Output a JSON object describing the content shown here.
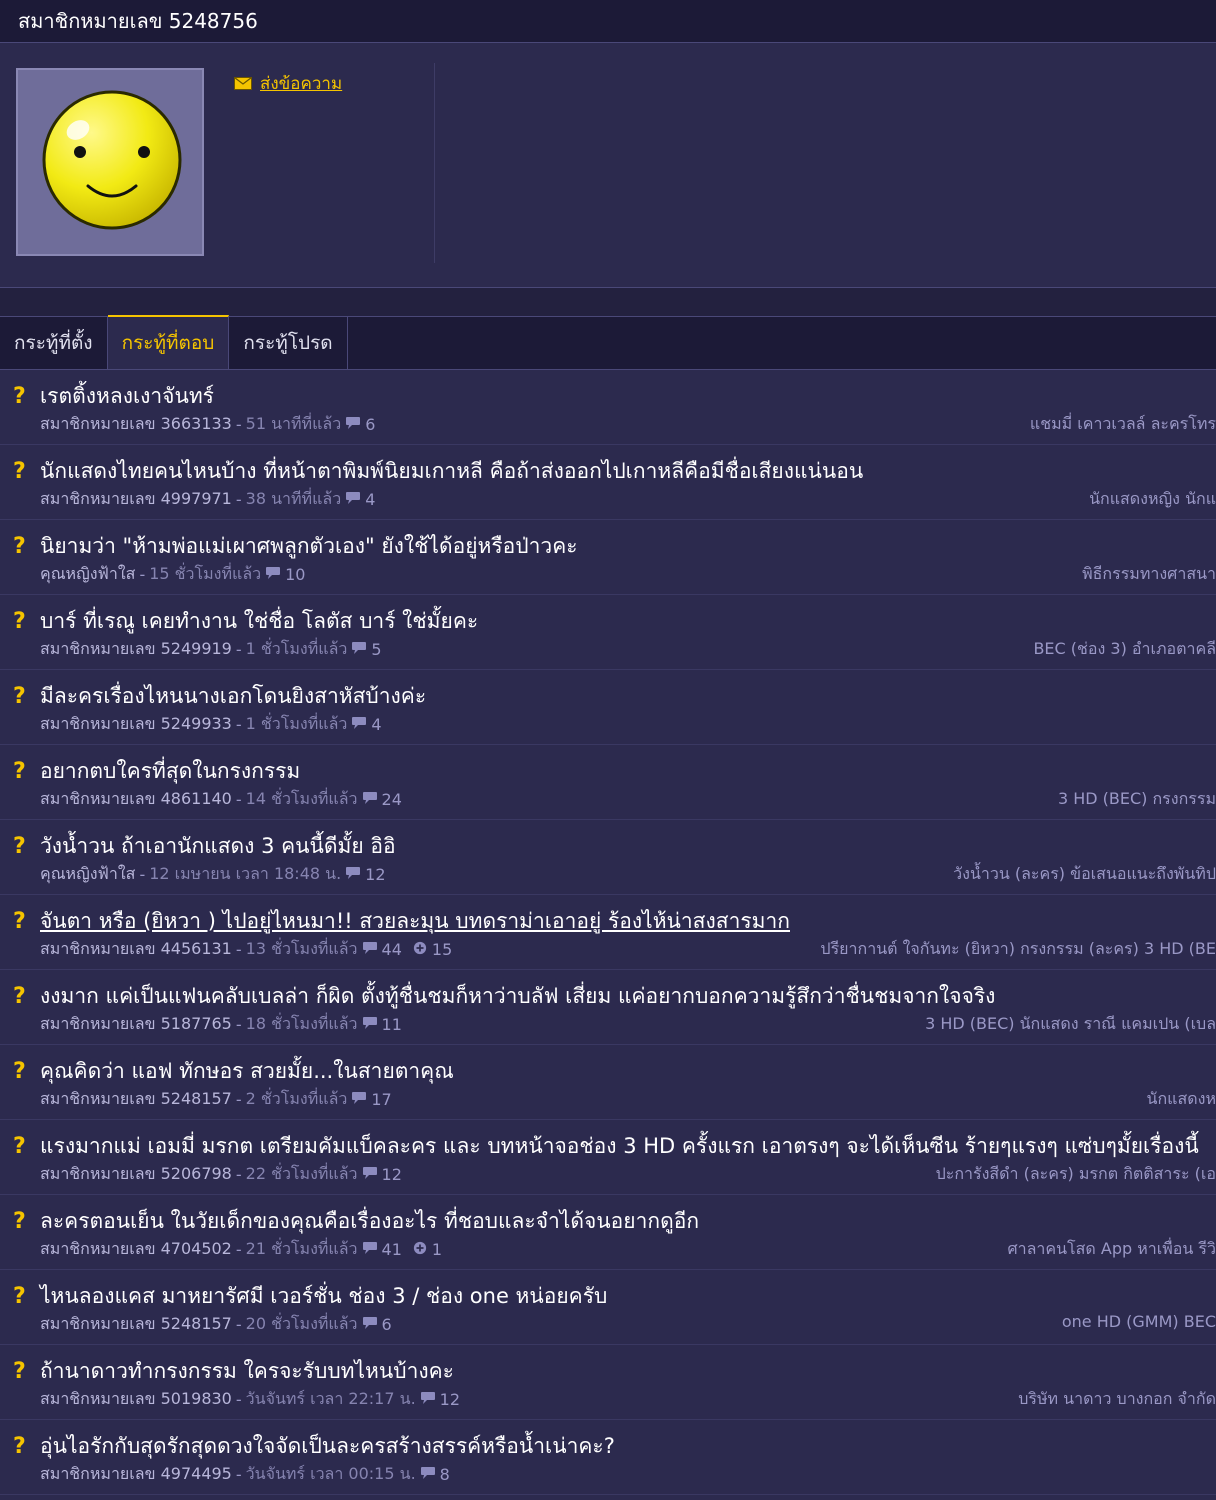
{
  "header": {
    "title": "สมาชิกหมายเลข 5248756"
  },
  "profile": {
    "send_message": "ส่งข้อความ"
  },
  "tabs": [
    {
      "label": "กระทู้ที่ตั้ง",
      "active": false
    },
    {
      "label": "กระทู้ที่ตอบ",
      "active": true
    },
    {
      "label": "กระทู้โปรด",
      "active": false
    }
  ],
  "topics": [
    {
      "title": "เรตติ้งหลงเงาจันทร์",
      "author": "สมาชิกหมายเลข 3663133",
      "time": "51 นาทีที่แล้ว",
      "comments": "6",
      "tags": "แชมมี่ เคาวเวลล์  ละครโทร"
    },
    {
      "title": "นักแสดงไทยคนไหนบ้าง ที่หน้าตาพิมพ์นิยมเกาหลี คือถ้าส่งออกไปเกาหลีคือมีชื่อเสียงแน่นอน",
      "author": "สมาชิกหมายเลข 4997971",
      "time": "38 นาทีที่แล้ว",
      "comments": "4",
      "tags": "นักแสดงหญิง  นักแ"
    },
    {
      "title": "นิยามว่า \"ห้ามพ่อแม่เผาศพลูกตัวเอง\" ยังใช้ได้อยู่หรือป่าวคะ",
      "author": "คุณหญิงฟ้าใส",
      "time": "15 ชั่วโมงที่แล้ว",
      "comments": "10",
      "tags": "พิธีกรรมทางศาสนา"
    },
    {
      "title": "บาร์ ที่เรณู เคยทำงาน ใช่ชื่อ โลตัส บาร์ ใช่มั้ยคะ",
      "author": "สมาชิกหมายเลข 5249919",
      "time": "1 ชั่วโมงที่แล้ว",
      "comments": "5",
      "tags": "BEC (ช่อง 3)  อำเภอตาคลี"
    },
    {
      "title": "มีละครเรื่องไหนนางเอกโดนยิงสาหัสบ้างค่ะ",
      "author": "สมาชิกหมายเลข 5249933",
      "time": "1 ชั่วโมงที่แล้ว",
      "comments": "4",
      "tags": ""
    },
    {
      "title": "อยากตบใครที่สุดในกรงกรรม",
      "author": "สมาชิกหมายเลข 4861140",
      "time": "14 ชั่วโมงที่แล้ว",
      "comments": "24",
      "tags": "3 HD (BEC)  กรงกรรม"
    },
    {
      "title": "วังน้ำวน ถ้าเอานักแสดง 3 คนนี้ดีมั้ย อิอิ",
      "author": "คุณหญิงฟ้าใส",
      "time": "12 เมษายน เวลา 18:48 น.",
      "comments": "12",
      "tags": "วังน้ำวน (ละคร)  ข้อเสนอแนะถึงพันทิป"
    },
    {
      "title": "จันตา หรือ (ยิหวา ) ไปอยู่ไหนมา!! สวยละมุน บทดราม่าเอาอยู่ ร้องไห้น่าสงสารมาก",
      "author": "สมาชิกหมายเลข 4456131",
      "time": "13 ชั่วโมงที่แล้ว",
      "comments": "44",
      "plus": "15",
      "underline": true,
      "tags": "ปรียากานต์ ใจกันทะ (ยิหวา)  กรงกรรม (ละคร)  3 HD (BE"
    },
    {
      "title": "งงมาก แค่เป็นแฟนคลับเบลล่า ก็ผิด ตั้งทู้ชื่นชมก็หาว่าบลัฟ เสี่ยม แค่อยากบอกความรู้สึกว่าชื่นชมจากใจจริง",
      "author": "สมาชิกหมายเลข 5187765",
      "time": "18 ชั่วโมงที่แล้ว",
      "comments": "11",
      "tags": "3 HD (BEC)  นักแสดง  ราณี แคมเปน (เบล"
    },
    {
      "title": "คุณคิดว่า แอฟ ทักษอร สวยมั้ย...ในสายตาคุณ",
      "author": "สมาชิกหมายเลข 5248157",
      "time": "2 ชั่วโมงที่แล้ว",
      "comments": "17",
      "tags": "นักแสดงห"
    },
    {
      "title": "แรงมากแม่ เอมมี่ มรกต เตรียมคัมแบ็คละคร และ บทหน้าจอช่อง 3 HD ครั้งแรก เอาตรงๆ จะได้เห็นซีน ร้ายๆแรงๆ แซ่บๆมั้ยเรื่องนี้",
      "author": "สมาชิกหมายเลข 5206798",
      "time": "22 ชั่วโมงที่แล้ว",
      "comments": "12",
      "tags": "ปะการังสีดำ (ละคร)  มรกต กิตติสาระ (เอ"
    },
    {
      "title": "ละครตอนเย็น ในวัยเด็กของคุณคือเรื่องอะไร ที่ชอบและจำได้จนอยากดูอีก",
      "author": "สมาชิกหมายเลข 4704502",
      "time": "21 ชั่วโมงที่แล้ว",
      "comments": "41",
      "plus": "1",
      "tags": "ศาลาคนโสด  App หาเพื่อน  รีวิ"
    },
    {
      "title": "ไหนลองแคส มาหยารัศมี เวอร์ชั่น ช่อง 3 / ช่อง one หน่อยครับ",
      "author": "สมาชิกหมายเลข 5248157",
      "time": "20 ชั่วโมงที่แล้ว",
      "comments": "6",
      "tags": "one HD (GMM)  BEC"
    },
    {
      "title": "ถ้านาดาวทำกรงกรรม ใครจะรับบทไหนบ้างคะ",
      "author": "สมาชิกหมายเลข 5019830",
      "time": "วันจันทร์ เวลา 22:17 น.",
      "comments": "12",
      "tags": "บริษัท นาดาว บางกอก จำกัด"
    },
    {
      "title": "อุ่นไอรักกับสุดรักสุดดวงใจจัดเป็นละครสร้างสรรค์หรือน้ำเน่าคะ?",
      "author": "สมาชิกหมายเลข 4974495",
      "time": "วันจันทร์ เวลา 00:15 น.",
      "comments": "8",
      "tags": ""
    }
  ]
}
